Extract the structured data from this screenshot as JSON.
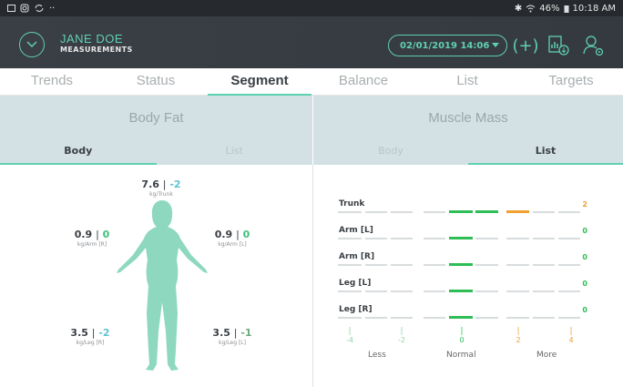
{
  "status_bar": {
    "left_icons": [
      "gallery-icon",
      "instagram-icon",
      "sync-icon",
      "more-icon"
    ],
    "bluetooth": "✱",
    "battery": "46%",
    "time": "10:18 AM"
  },
  "header": {
    "user_name": "JANE DOE",
    "subtitle": "MEASUREMENTS",
    "date_value": "02/01/2019 14:06",
    "add_label": "(+)",
    "accent_color": "#5fd0b0"
  },
  "tabs": [
    {
      "label": "Trends"
    },
    {
      "label": "Status"
    },
    {
      "label": "Segment"
    },
    {
      "label": "Balance"
    },
    {
      "label": "List"
    },
    {
      "label": "Targets"
    }
  ],
  "body_fat": {
    "title": "Body Fat",
    "subtabs": [
      "Body",
      "List"
    ],
    "measures": {
      "trunk": {
        "value": "7.6",
        "delta": "-2",
        "unit": "kg/Trunk"
      },
      "arm_r": {
        "value": "0.9",
        "delta": "0",
        "unit": "kg/Arm [R]"
      },
      "arm_l": {
        "value": "0.9",
        "delta": "0",
        "unit": "kg/Arm [L]"
      },
      "leg_r": {
        "value": "3.5",
        "delta": "-2",
        "unit": "kg/Leg [R]"
      },
      "leg_l": {
        "value": "3.5",
        "delta": "-1",
        "unit": "kg/Leg [L]"
      }
    }
  },
  "muscle_mass": {
    "title": "Muscle Mass",
    "subtabs": [
      "Body",
      "List"
    ],
    "rows": [
      {
        "label": "Trunk",
        "value": "2"
      },
      {
        "label": "Arm [L]",
        "value": "0"
      },
      {
        "label": "Arm [R]",
        "value": "0"
      },
      {
        "label": "Leg [L]",
        "value": "0"
      },
      {
        "label": "Leg [R]",
        "value": "0"
      }
    ],
    "scale": [
      "-4",
      "-2",
      "0",
      "2",
      "4"
    ],
    "scale_labels": {
      "less": "Less",
      "normal": "Normal",
      "more": "More"
    }
  }
}
